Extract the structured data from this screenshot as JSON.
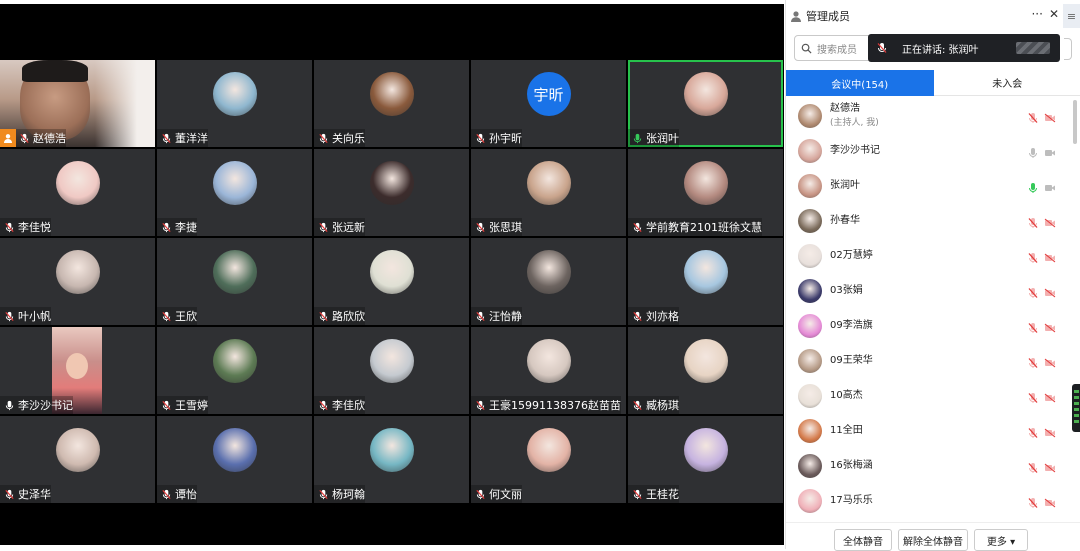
{
  "video": {
    "tiles": [
      {
        "name": "赵德浩",
        "kind": "video",
        "host": true
      },
      {
        "name": "董洋洋",
        "kind": "photo",
        "color": "#8fb7cf"
      },
      {
        "name": "关向乐",
        "kind": "photo",
        "color": "#8a5a3c"
      },
      {
        "name": "孙宇昕",
        "kind": "text",
        "avatar_text": "宇昕"
      },
      {
        "name": "张润叶",
        "kind": "photo",
        "color": "#d8a89a",
        "speaking": true
      },
      {
        "name": "李佳悦",
        "kind": "photo",
        "color": "#f0c9c4"
      },
      {
        "name": "李捷",
        "kind": "photo",
        "color": "#9bb6d8"
      },
      {
        "name": "张远新",
        "kind": "photo",
        "color": "#3c2c2c"
      },
      {
        "name": "张思琪",
        "kind": "photo",
        "color": "#c9a48c"
      },
      {
        "name": "学前教育2101班徐文慧",
        "kind": "photo",
        "color": "#b48a80"
      },
      {
        "name": "叶小帆",
        "kind": "photo",
        "color": "#c7b7b0"
      },
      {
        "name": "王欣",
        "kind": "photo",
        "color": "#4f6e5a"
      },
      {
        "name": "路欣欣",
        "kind": "photo",
        "color": "#dfe0d4"
      },
      {
        "name": "汪怡静",
        "kind": "photo",
        "color": "#6d6460"
      },
      {
        "name": "刘亦格",
        "kind": "photo",
        "color": "#a7c7e0"
      },
      {
        "name": "李沙沙书记",
        "kind": "portrait"
      },
      {
        "name": "王雪婷",
        "kind": "photo",
        "color": "#5d7b54"
      },
      {
        "name": "李佳欣",
        "kind": "photo",
        "color": "#c5cad0"
      },
      {
        "name": "王豪15991138376赵苗苗",
        "kind": "photo",
        "color": "#d6c8c0"
      },
      {
        "name": "臧杨琪",
        "kind": "photo",
        "color": "#e7d4c4"
      },
      {
        "name": "史泽华",
        "kind": "photo",
        "color": "#cfbab0"
      },
      {
        "name": "谭怡",
        "kind": "photo",
        "color": "#5a6fae"
      },
      {
        "name": "杨珂翰",
        "kind": "photo",
        "color": "#76b7c4"
      },
      {
        "name": "何文丽",
        "kind": "photo",
        "color": "#e3b3a6"
      },
      {
        "name": "王桂花",
        "kind": "photo",
        "color": "#c6b3e0"
      }
    ]
  },
  "panel": {
    "title": "管理成员",
    "more_icon": "···",
    "close_icon": "✕",
    "side_icon": "≡",
    "search_placeholder": "搜索成员",
    "tooltip_text": "正在讲话: 张润叶",
    "tabs": [
      {
        "label": "会议中(154)",
        "active": true
      },
      {
        "label": "未入会",
        "active": false
      }
    ],
    "members": [
      {
        "name": "赵德浩",
        "sub": "(主持人, 我)",
        "mic": "muted",
        "color": "#b08a70"
      },
      {
        "name": "李沙沙书记",
        "sub": "",
        "mic": "on",
        "color": "#d6a69c"
      },
      {
        "name": "张润叶",
        "sub": "",
        "mic": "speaking",
        "color": "#c89585"
      },
      {
        "name": "孙春华",
        "sub": "",
        "mic": "muted",
        "color": "#7a6a5a"
      },
      {
        "name": "02万慧婷",
        "sub": "",
        "mic": "muted",
        "color": "#e8e0dc"
      },
      {
        "name": "03张娟",
        "sub": "",
        "mic": "muted",
        "color": "#3b3a6a"
      },
      {
        "name": "09李浩旗",
        "sub": "",
        "mic": "muted",
        "color": "#e58ad6"
      },
      {
        "name": "09王荣华",
        "sub": "",
        "mic": "muted",
        "color": "#b59a86"
      },
      {
        "name": "10高杰",
        "sub": "",
        "mic": "muted",
        "color": "#e8e0d8"
      },
      {
        "name": "11全田",
        "sub": "",
        "mic": "muted",
        "color": "#d47a4a"
      },
      {
        "name": "16张梅涵",
        "sub": "",
        "mic": "muted",
        "color": "#6a5a5a"
      },
      {
        "name": "17马乐乐",
        "sub": "",
        "mic": "muted",
        "color": "#f0b0b8"
      }
    ],
    "footer": {
      "mute_all": "全体静音",
      "unmute_all": "解除全体静音",
      "more": "更多 ▾"
    }
  }
}
